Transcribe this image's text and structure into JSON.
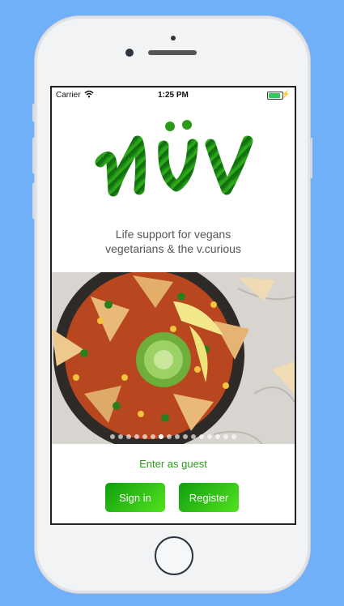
{
  "status_bar": {
    "carrier": "Carrier",
    "time": "1:25 PM"
  },
  "app": {
    "logo_text": "NÜV",
    "tagline": [
      "Life support for vegans",
      "vegetarians & the v.curious"
    ]
  },
  "carousel": {
    "total_pages": 16,
    "active_index": 6
  },
  "actions": {
    "guest_label": "Enter as guest",
    "signin_label": "Sign in",
    "register_label": "Register"
  },
  "colors": {
    "brand_green": "#2e9a1c",
    "button_start": "#0f9f0f",
    "button_end": "#53e21e",
    "background": "#6fb0f8"
  },
  "icons": [
    "wifi-icon",
    "battery-icon",
    "charging-icon"
  ]
}
